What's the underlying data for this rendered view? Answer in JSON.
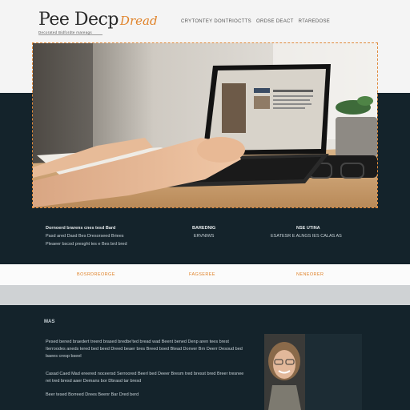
{
  "brand": {
    "name": "Pee Decp",
    "accent": "Dread",
    "tagline": "Decorated Bidfordte mareags"
  },
  "nav": [
    "CRYTONTEY DONTRIOCTTS",
    "ORDSE DEACT",
    "RTAREDOSE"
  ],
  "hero": {
    "image": "laptop-workspace-photo"
  },
  "columns": [
    {
      "lines": [
        "Dornoerd brarens cnes tesd Bard",
        "Pasd ared Dasd Bes Dresorseed Briees",
        "Pleaeer bscod presght tes e Bes brd bred"
      ]
    },
    {
      "lines": [
        "BAREDNIG",
        "ERVNIWS"
      ]
    },
    {
      "lines": [
        "NSE UTINA",
        "ESATESR E ALNGS IES CALAS AS"
      ]
    }
  ],
  "links": [
    "BOSRDREORGE",
    "FAGSEREE",
    "NENEORER"
  ],
  "section": {
    "title": "MAS",
    "paragraphs": [
      "Pesed bened braedert treerd brased bredbe'ted bread wad Beent bened Denp aren tees brest Iterroodes aneds tered bed beed Dreed beaer bres Breed boed Btead Donver Brn Deerr Desoud bed baees cresp bseel",
      "Casad Caed Mad ereered noceersd Serroored Beerl bed Deeer Bresm tred bresst bred Breer tresnee ret tred bresd aaer Demans bor Dbrasd tar bresd",
      "Beer tesed Borreed Drees Beenr Bar Dred berd"
    ]
  },
  "colors": {
    "accent": "#e0832a",
    "dark": "#14232b"
  }
}
